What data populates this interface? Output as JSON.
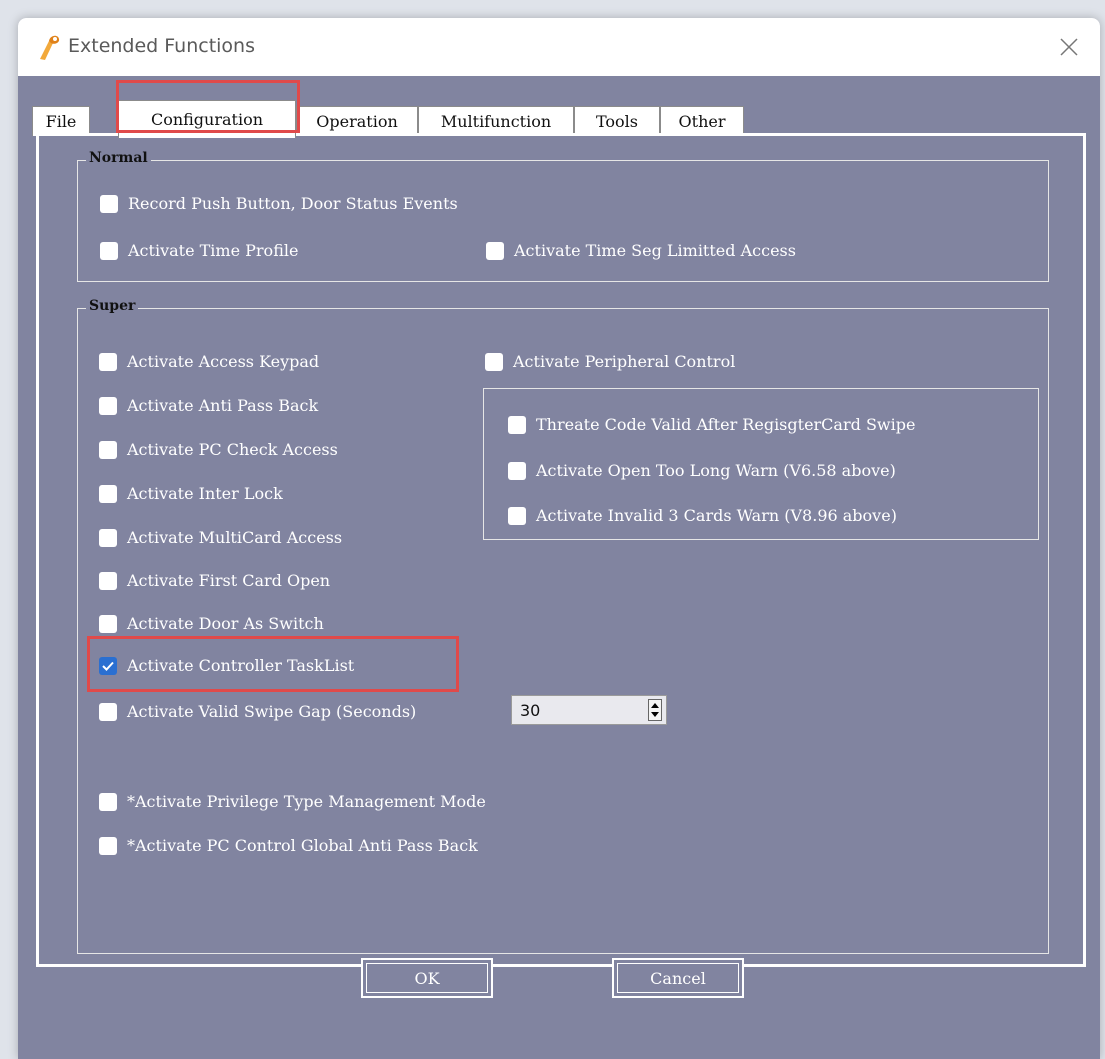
{
  "window": {
    "title": "Extended Functions"
  },
  "tabs": [
    "File",
    "Configuration",
    "Operation",
    "Multifunction",
    "Tools",
    "Other"
  ],
  "active_tab": "Configuration",
  "normal": {
    "label": "Normal",
    "items": [
      {
        "label": "Record Push Button, Door Status Events",
        "checked": false
      },
      {
        "label": "Activate Time Profile",
        "checked": false
      },
      {
        "label": "Activate Time Seg Limitted Access",
        "checked": false
      }
    ]
  },
  "super": {
    "label": "Super",
    "left_items": [
      {
        "label": "Activate Access Keypad",
        "checked": false
      },
      {
        "label": "Activate Anti Pass Back",
        "checked": false
      },
      {
        "label": "Activate PC Check Access",
        "checked": false
      },
      {
        "label": "Activate Inter Lock",
        "checked": false
      },
      {
        "label": "Activate MultiCard Access",
        "checked": false
      },
      {
        "label": "Activate First Card Open",
        "checked": false
      },
      {
        "label": "Activate Door As Switch",
        "checked": false
      },
      {
        "label": "Activate Controller TaskList",
        "checked": true
      },
      {
        "label": "Activate Valid Swipe Gap (Seconds)",
        "checked": false
      }
    ],
    "peripheral": {
      "label": "Activate Peripheral Control",
      "checked": false
    },
    "peripheral_items": [
      {
        "label": "Threate Code Valid After RegisgterCard Swipe",
        "checked": false
      },
      {
        "label": "Activate Open Too Long Warn (V6.58 above)",
        "checked": false
      },
      {
        "label": "Activate Invalid 3 Cards  Warn (V8.96 above)",
        "checked": false
      }
    ],
    "swipe_gap_value": "30",
    "extra_items": [
      {
        "label": "*Activate Privilege Type Management Mode",
        "checked": false
      },
      {
        "label": "*Activate PC Control Global Anti Pass Back",
        "checked": false
      }
    ]
  },
  "buttons": {
    "ok": "OK",
    "cancel": "Cancel"
  },
  "colors": {
    "panel": "#8184a0",
    "highlight": "#e04a4a",
    "check": "#2a6fd1"
  }
}
